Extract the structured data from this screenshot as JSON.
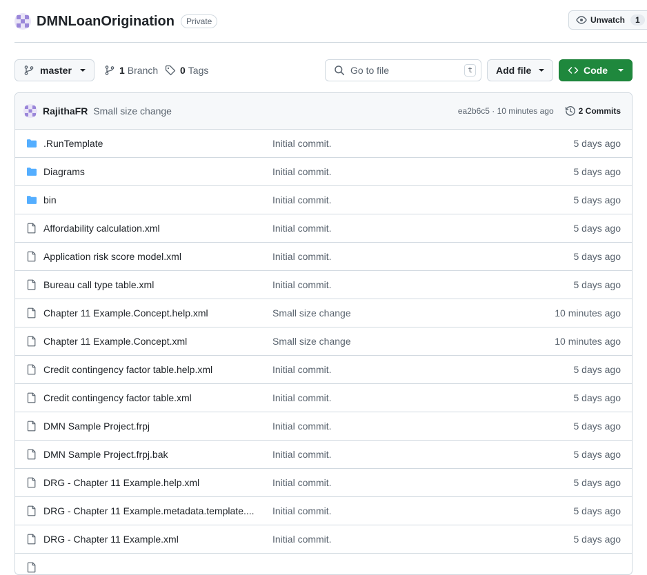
{
  "repo": {
    "name": "DMNLoanOrigination",
    "visibility": "Private"
  },
  "watch": {
    "label": "Unwatch",
    "count": "1"
  },
  "toolbar": {
    "branch": "master",
    "branches_count": "1",
    "branches_label": "Branch",
    "tags_count": "0",
    "tags_label": "Tags",
    "search_placeholder": "Go to file",
    "search_shortcut": "t",
    "add_file_label": "Add file",
    "code_label": "Code"
  },
  "latest_commit": {
    "author": "RajithaFR",
    "message": "Small size change",
    "sha_time": "ea2b6c5 · 10 minutes ago",
    "commits_label": "2 Commits"
  },
  "files": [
    {
      "type": "folder",
      "name": ".RunTemplate",
      "message": "Initial commit.",
      "date": "5 days ago"
    },
    {
      "type": "folder",
      "name": "Diagrams",
      "message": "Initial commit.",
      "date": "5 days ago"
    },
    {
      "type": "folder",
      "name": "bin",
      "message": "Initial commit.",
      "date": "5 days ago"
    },
    {
      "type": "file",
      "name": "Affordability calculation.xml",
      "message": "Initial commit.",
      "date": "5 days ago"
    },
    {
      "type": "file",
      "name": "Application risk score model.xml",
      "message": "Initial commit.",
      "date": "5 days ago"
    },
    {
      "type": "file",
      "name": "Bureau call type table.xml",
      "message": "Initial commit.",
      "date": "5 days ago"
    },
    {
      "type": "file",
      "name": "Chapter 11 Example.Concept.help.xml",
      "message": "Small size change",
      "date": "10 minutes ago"
    },
    {
      "type": "file",
      "name": "Chapter 11 Example.Concept.xml",
      "message": "Small size change",
      "date": "10 minutes ago"
    },
    {
      "type": "file",
      "name": "Credit contingency factor table.help.xml",
      "message": "Initial commit.",
      "date": "5 days ago"
    },
    {
      "type": "file",
      "name": "Credit contingency factor table.xml",
      "message": "Initial commit.",
      "date": "5 days ago"
    },
    {
      "type": "file",
      "name": "DMN Sample Project.frpj",
      "message": "Initial commit.",
      "date": "5 days ago"
    },
    {
      "type": "file",
      "name": "DMN Sample Project.frpj.bak",
      "message": "Initial commit.",
      "date": "5 days ago"
    },
    {
      "type": "file",
      "name": "DRG - Chapter 11 Example.help.xml",
      "message": "Initial commit.",
      "date": "5 days ago"
    },
    {
      "type": "file",
      "name": "DRG - Chapter 11 Example.metadata.template....",
      "message": "Initial commit.",
      "date": "5 days ago"
    },
    {
      "type": "file",
      "name": "DRG - Chapter 11 Example.xml",
      "message": "Initial commit.",
      "date": "5 days ago"
    },
    {
      "type": "file",
      "name": "",
      "message": "",
      "date": ""
    }
  ],
  "colors": {
    "folder": "#54aeff",
    "primary": "#1f883d",
    "muted": "#59636e",
    "border": "#d1d9e0"
  },
  "icons": [
    "repo-avatar-icon",
    "eye-icon",
    "branch-icon",
    "tag-icon",
    "search-icon",
    "code-icon",
    "history-icon",
    "folder-icon",
    "file-icon"
  ]
}
